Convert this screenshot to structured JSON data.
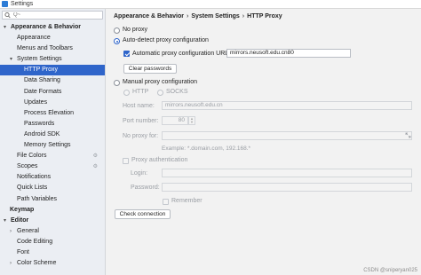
{
  "window": {
    "title": "Settings"
  },
  "search": {
    "placeholder": "Q~"
  },
  "sidebar": {
    "items": [
      {
        "label": "Appearance & Behavior",
        "arrow": "▾",
        "bold": true
      },
      {
        "label": "Appearance"
      },
      {
        "label": "Menus and Toolbars"
      },
      {
        "label": "System Settings",
        "arrow": "▾"
      },
      {
        "label": "HTTP Proxy",
        "selected": true
      },
      {
        "label": "Data Sharing"
      },
      {
        "label": "Date Formats"
      },
      {
        "label": "Updates"
      },
      {
        "label": "Process Elevation"
      },
      {
        "label": "Passwords"
      },
      {
        "label": "Android SDK"
      },
      {
        "label": "Memory Settings"
      },
      {
        "label": "File Colors",
        "config_icon": "⚙"
      },
      {
        "label": "Scopes",
        "config_icon": "⚙"
      },
      {
        "label": "Notifications"
      },
      {
        "label": "Quick Lists"
      },
      {
        "label": "Path Variables"
      },
      {
        "label": "Keymap",
        "bold": true
      },
      {
        "label": "Editor",
        "arrow": "▾",
        "bold": true
      },
      {
        "label": "General",
        "arrow": "›"
      },
      {
        "label": "Code Editing"
      },
      {
        "label": "Font"
      },
      {
        "label": "Color Scheme",
        "arrow": "›"
      }
    ]
  },
  "breadcrumb": {
    "part1": "Appearance & Behavior",
    "sep": "›",
    "part2": "System Settings",
    "part3": "HTTP Proxy"
  },
  "proxy": {
    "no_proxy_label": "No proxy",
    "auto_detect_label": "Auto-detect proxy configuration",
    "auto_url_label": "Automatic proxy configuration URL:",
    "auto_url_value": "mirrors.neusoft.edu.cn80",
    "clear_passwords_label": "Clear passwords",
    "manual_label": "Manual proxy configuration",
    "http_label": "HTTP",
    "socks_label": "SOCKS",
    "host_label": "Host name:",
    "host_value": "mirrors.neusoft.edu.cn",
    "port_label": "Port number:",
    "port_value": "80",
    "no_proxy_for_label": "No proxy for:",
    "example_text": "Example: *.domain.com, 192.168.*",
    "auth_label": "Proxy authentication",
    "login_label": "Login:",
    "password_label": "Password:",
    "remember_label": "Remember",
    "check_connection_label": "Check connection"
  },
  "watermark": "CSDN @sniperyan025",
  "colors": {
    "accent": "#2f65ca",
    "sidebar_bg": "#ebeef3",
    "content_bg": "#f2f2f2"
  }
}
